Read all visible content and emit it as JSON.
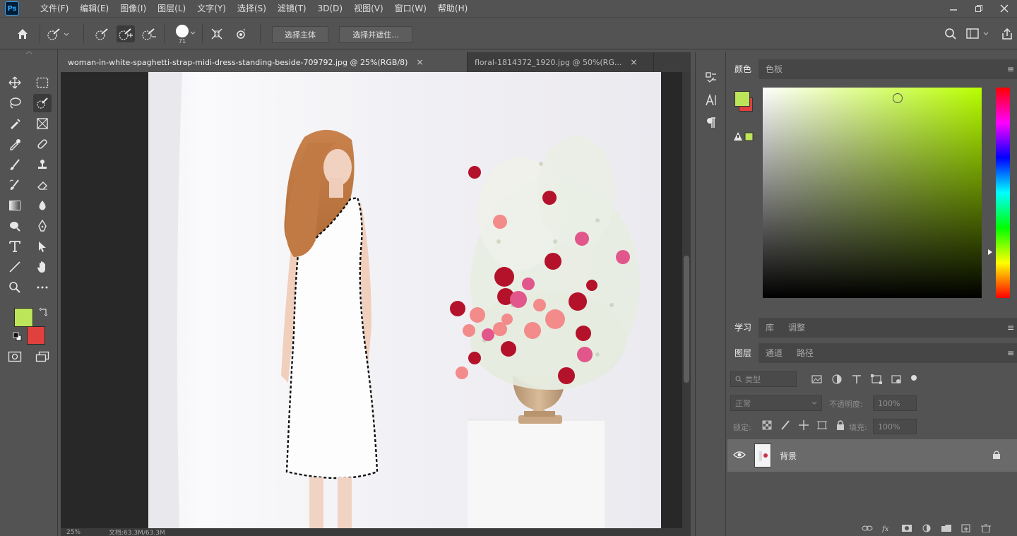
{
  "app": {
    "logo": "Ps"
  },
  "menus": [
    "文件(F)",
    "编辑(E)",
    "图像(I)",
    "图层(L)",
    "文字(Y)",
    "选择(S)",
    "滤镜(T)",
    "3D(D)",
    "视图(V)",
    "窗口(W)",
    "帮助(H)"
  ],
  "options": {
    "brush_size": "71",
    "select_subject": "选择主体",
    "select_and_mask": "选择并遮住..."
  },
  "tabs": [
    {
      "label": "woman-in-white-spaghetti-strap-midi-dress-standing-beside-709792.jpg @ 25%(RGB/8)",
      "close": "×"
    },
    {
      "label": "floral-1814372_1920.jpg @ 50%(RG...",
      "close": "×"
    }
  ],
  "status": {
    "zoom": "25%",
    "doc": "文档:63.3M/63.3M"
  },
  "colors": {
    "foreground": "#bce55a",
    "background": "#e0413e",
    "picker_hue": "#b8ff00"
  },
  "panels": {
    "color_tabs": [
      "颜色",
      "色板"
    ],
    "learn_tabs": [
      "学习",
      "库",
      "调整"
    ],
    "layer_tabs": [
      "图层",
      "通道",
      "路径"
    ],
    "filter_placeholder": "类型",
    "blend_mode": "正常",
    "opacity_label": "不透明度:",
    "opacity_value": "100%",
    "lock_label": "锁定:",
    "fill_label": "填充:",
    "fill_value": "100%",
    "layer_name": "背景",
    "menu_glyph": "≡"
  }
}
